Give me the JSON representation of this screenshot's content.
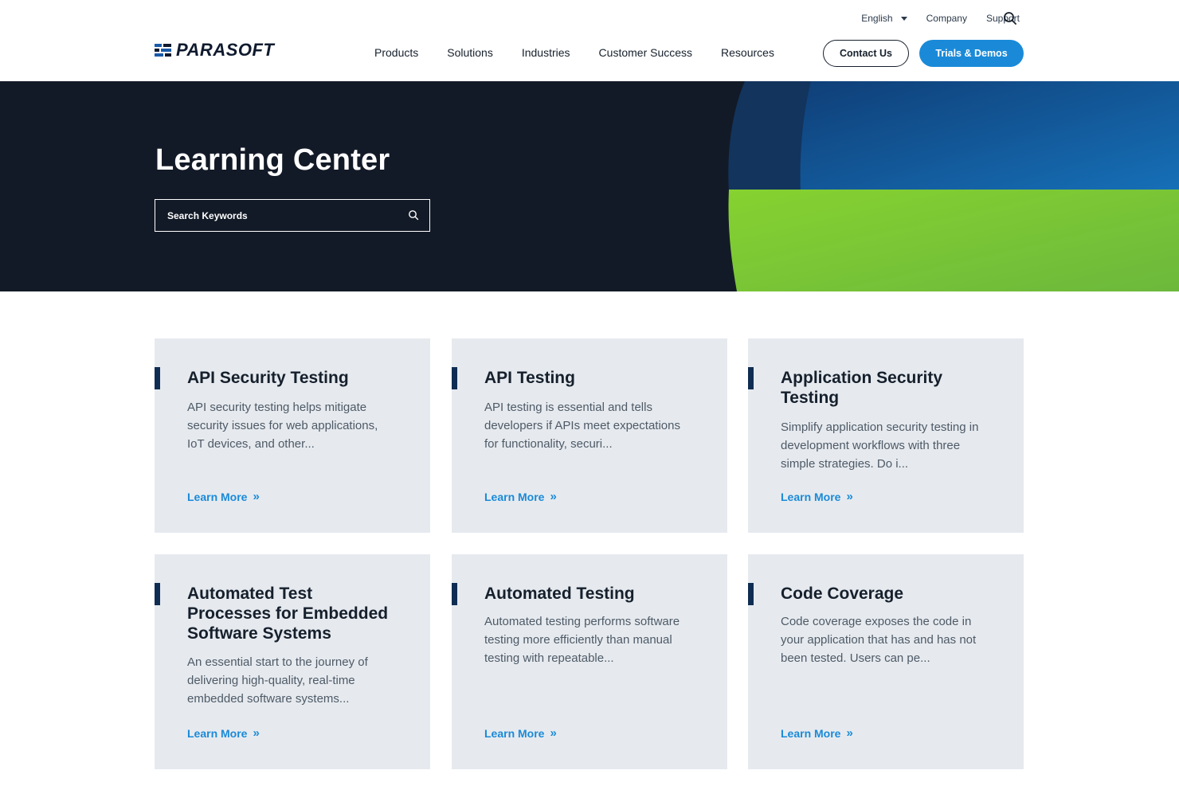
{
  "header": {
    "logo": "PARASOFT",
    "utility": {
      "language": "English",
      "company": "Company",
      "support": "Support"
    },
    "nav": [
      "Products",
      "Solutions",
      "Industries",
      "Customer Success",
      "Resources"
    ],
    "contact_label": "Contact Us",
    "trials_label": "Trials & Demos"
  },
  "hero": {
    "title": "Learning Center",
    "search_placeholder": "Search Keywords"
  },
  "cards": [
    {
      "title": "API Security Testing",
      "description": "API security testing helps mitigate security issues for web applications, IoT devices, and other...",
      "link": "Learn More"
    },
    {
      "title": "API Testing",
      "description": "API testing is essential and tells developers if APIs meet expectations for functionality, securi...",
      "link": "Learn More"
    },
    {
      "title": "Application Security Testing",
      "description": "Simplify application security testing in development workflows with three simple strategies. Do i...",
      "link": "Learn More"
    },
    {
      "title": "Automated Test Processes for Embedded Software Systems",
      "description": "An essential start to the journey of delivering high-quality, real-time embedded software systems...",
      "link": "Learn More"
    },
    {
      "title": "Automated Testing",
      "description": "Automated testing performs software testing more efficiently than manual testing with repeatable...",
      "link": "Learn More"
    },
    {
      "title": "Code Coverage",
      "description": "Code coverage exposes the code in your application that has and has not been tested. Users can pe...",
      "link": "Learn More"
    }
  ],
  "colors": {
    "brand_blue": "#1a8ad8",
    "hero_bg": "#131a27",
    "hero_green": "#7dc936",
    "hero_blue": "#1060a0",
    "card_bg": "#e6eaef",
    "accent_bar": "#0f2d52"
  },
  "icons": {
    "search": "search-icon",
    "caret": "chevron-down-icon",
    "learn_more": "double-chevron-right-icon"
  }
}
